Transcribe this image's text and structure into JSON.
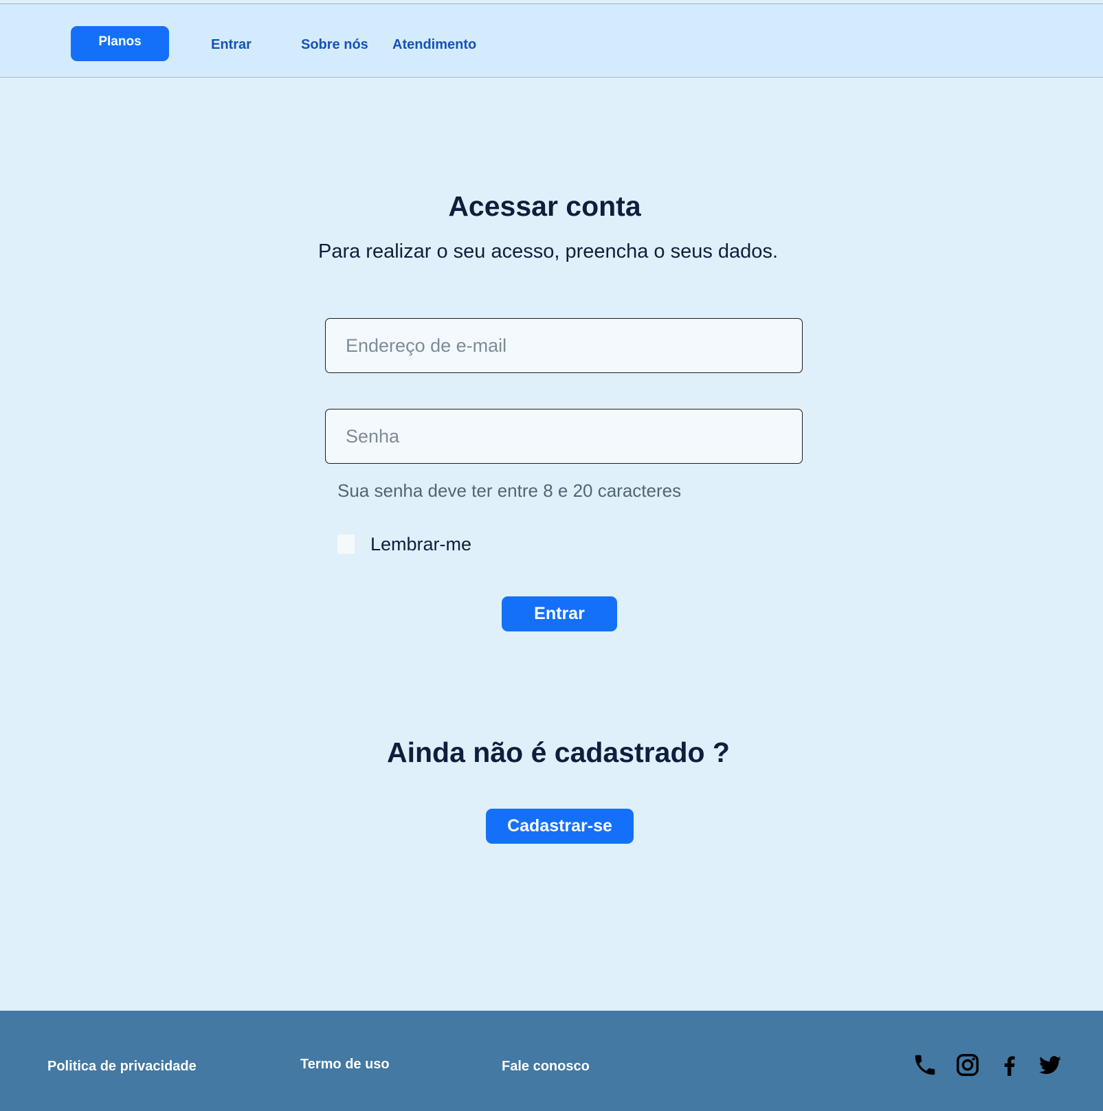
{
  "nav": {
    "plans_label": "Planos",
    "login_label": "Entrar",
    "about_label": "Sobre nós",
    "support_label": "Atendimento"
  },
  "login": {
    "title": "Acessar conta",
    "subtitle": "Para realizar o seu acesso, preencha o seus dados.",
    "email_placeholder": "Endereço de e-mail",
    "password_placeholder": "Senha",
    "password_hint": "Sua senha deve ter entre 8 e 20 caracteres",
    "remember_label": "Lembrar-me",
    "remember_checked": false,
    "submit_label": "Entrar"
  },
  "signup": {
    "title": "Ainda não é cadastrado ?",
    "button_label": "Cadastrar-se"
  },
  "footer": {
    "privacy_label": "Politica de privacidade",
    "terms_label": "Termo de uso",
    "contact_label": "Fale conosco",
    "icons": [
      "phone-icon",
      "instagram-icon",
      "facebook-icon",
      "twitter-icon"
    ]
  },
  "colors": {
    "accent": "#1570f9",
    "nav_background": "#d4ebfd",
    "page_background": "#dff0fa",
    "footer_background": "#4379a3",
    "nav_link": "#1553b7"
  }
}
